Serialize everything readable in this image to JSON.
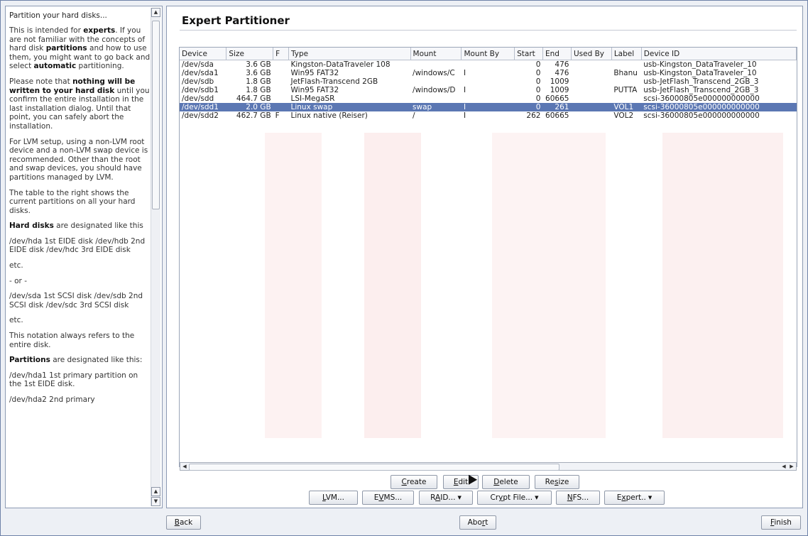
{
  "help": {
    "title": "Partition your hard disks...",
    "paragraphs": [
      [
        {
          "t": "This is intended for "
        },
        {
          "t": "experts",
          "b": true
        },
        {
          "t": ". If you are not familiar with the concepts of hard disk "
        },
        {
          "t": "partitions",
          "b": true
        },
        {
          "t": " and how to use them, you might want to go back and select "
        },
        {
          "t": "automatic",
          "b": true
        },
        {
          "t": " partitioning."
        }
      ],
      [
        {
          "t": "Please note that "
        },
        {
          "t": "nothing will be written to your hard disk",
          "b": true
        },
        {
          "t": " until you confirm the entire installation in the last installation dialog. Until that point, you can safely abort the installation."
        }
      ],
      [
        {
          "t": "For LVM setup, using a non-LVM root device and a non-LVM swap device is recommended. Other than the root and swap devices, you should have partitions managed by LVM."
        }
      ],
      [
        {
          "t": "The table to the right shows the current partitions on all your hard disks."
        }
      ],
      [
        {
          "t": "Hard disks",
          "b": true
        },
        {
          "t": " are designated like this"
        }
      ],
      [
        {
          "t": "/dev/hda  1st EIDE disk /dev/hdb  2nd EIDE disk /dev/hdc  3rd EIDE disk"
        }
      ],
      [
        {
          "t": "etc."
        }
      ],
      [
        {
          "t": "- or -"
        }
      ],
      [
        {
          "t": "/dev/sda  1st SCSI disk /dev/sdb  2nd SCSI disk /dev/sdc  3rd SCSI disk"
        }
      ],
      [
        {
          "t": "etc."
        }
      ],
      [
        {
          "t": "This notation always refers to the entire disk."
        }
      ],
      [
        {
          "t": "Partitions",
          "b": true
        },
        {
          "t": " are designated like this:"
        }
      ],
      [
        {
          "t": "/dev/hda1  1st primary partition on the 1st EIDE disk."
        }
      ],
      [
        {
          "t": "/dev/hda2  2nd primary"
        }
      ]
    ]
  },
  "main": {
    "title": "Expert Partitioner",
    "columns": [
      "Device",
      "Size",
      "F",
      "Type",
      "Mount",
      "Mount By",
      "Start",
      "End",
      "Used By",
      "Label",
      "Device ID"
    ],
    "rows": [
      {
        "device": "/dev/sda",
        "size": "3.6 GB",
        "f": "",
        "type": "Kingston-DataTraveler 108",
        "mount": "",
        "mountby": "",
        "start": "0",
        "end": "476",
        "usedby": "",
        "label": "",
        "id": "usb-Kingston_DataTraveler_10",
        "selected": false
      },
      {
        "device": "/dev/sda1",
        "size": "3.6 GB",
        "f": "",
        "type": "Win95 FAT32",
        "mount": "/windows/C",
        "mountby": "I",
        "start": "0",
        "end": "476",
        "usedby": "",
        "label": "Bhanu",
        "id": "usb-Kingston_DataTraveler_10",
        "selected": false
      },
      {
        "device": "/dev/sdb",
        "size": "1.8 GB",
        "f": "",
        "type": "JetFlash-Transcend 2GB",
        "mount": "",
        "mountby": "",
        "start": "0",
        "end": "1009",
        "usedby": "",
        "label": "",
        "id": "usb-JetFlash_Transcend_2GB_3",
        "selected": false
      },
      {
        "device": "/dev/sdb1",
        "size": "1.8 GB",
        "f": "",
        "type": "Win95 FAT32",
        "mount": "/windows/D",
        "mountby": "I",
        "start": "0",
        "end": "1009",
        "usedby": "",
        "label": "PUTTA",
        "id": "usb-JetFlash_Transcend_2GB_3",
        "selected": false
      },
      {
        "device": "/dev/sdd",
        "size": "464.7 GB",
        "f": "",
        "type": "LSI-MegaSR",
        "mount": "",
        "mountby": "",
        "start": "0",
        "end": "60665",
        "usedby": "",
        "label": "",
        "id": "scsi-36000805e000000000000",
        "selected": false
      },
      {
        "device": "/dev/sdd1",
        "size": "2.0 GB",
        "f": "",
        "type": "Linux swap",
        "mount": "swap",
        "mountby": "I",
        "start": "0",
        "end": "261",
        "usedby": "",
        "label": "VOL1",
        "id": "scsi-36000805e000000000000",
        "selected": true
      },
      {
        "device": "/dev/sdd2",
        "size": "462.7 GB",
        "f": "F",
        "type": "Linux native (Reiser)",
        "mount": "/",
        "mountby": "I",
        "start": "262",
        "end": "60665",
        "usedby": "",
        "label": "VOL2",
        "id": "scsi-36000805e000000000000",
        "selected": false
      }
    ]
  },
  "buttons": {
    "create": {
      "pre": "",
      "u": "C",
      "post": "reate"
    },
    "edit": {
      "pre": "",
      "u": "E",
      "post": "dit"
    },
    "delete": {
      "pre": "",
      "u": "D",
      "post": "elete"
    },
    "resize": {
      "pre": "Re",
      "u": "s",
      "post": "ize"
    },
    "lvm": {
      "pre": "",
      "u": "L",
      "post": "VM..."
    },
    "evms": {
      "pre": "E",
      "u": "V",
      "post": "MS..."
    },
    "raid": {
      "pre": "R",
      "u": "A",
      "post": "ID..."
    },
    "crypt": {
      "pre": "Cr",
      "u": "y",
      "post": "pt File..."
    },
    "nfs": {
      "pre": "",
      "u": "N",
      "post": "FS..."
    },
    "expert": {
      "pre": "E",
      "u": "x",
      "post": "pert.."
    },
    "back": {
      "pre": "",
      "u": "B",
      "post": "ack"
    },
    "abort": {
      "pre": "Abo",
      "u": "r",
      "post": "t"
    },
    "finish": {
      "pre": "",
      "u": "F",
      "post": "inish"
    }
  }
}
